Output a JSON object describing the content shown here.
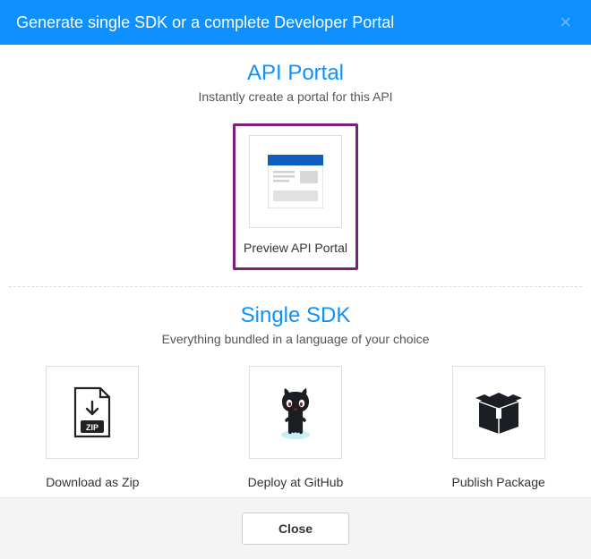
{
  "header": {
    "title": "Generate single SDK or a complete Developer Portal",
    "close_icon": "×"
  },
  "sections": {
    "portal": {
      "heading": "API Portal",
      "sub": "Instantly create a portal for this API",
      "card_label": "Preview API Portal"
    },
    "sdk": {
      "heading": "Single SDK",
      "sub": "Everything bundled in a language of your choice",
      "cards": {
        "zip": "Download as Zip",
        "github": "Deploy at GitHub",
        "pkg": "Publish Package"
      }
    }
  },
  "footer": {
    "close_label": "Close"
  }
}
